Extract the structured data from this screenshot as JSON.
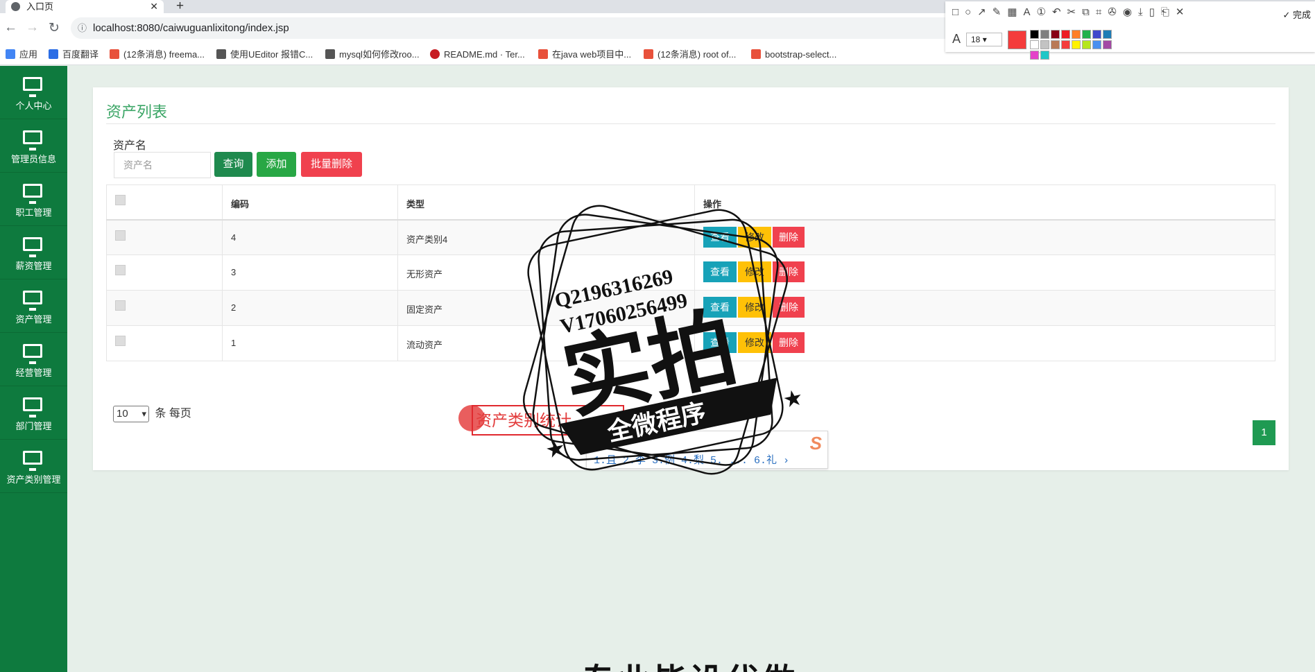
{
  "browser": {
    "tab_title": "入口页",
    "url": "localhost:8080/caiwuguanlixitong/index.jsp",
    "bookmarks": [
      {
        "label": "应用",
        "color": "#4285f4"
      },
      {
        "label": "百度翻译",
        "color": "#2b6de5"
      },
      {
        "label": "(12条消息) freema...",
        "color": "#e8513b"
      },
      {
        "label": "使用UEditor 报错C...",
        "color": "#555555"
      },
      {
        "label": "mysql如何修改roo...",
        "color": "#555555"
      },
      {
        "label": "README.md · Ter...",
        "color": "#c71d23"
      },
      {
        "label": "在java web项目中...",
        "color": "#e8513b"
      },
      {
        "label": "(12条消息) root of...",
        "color": "#e8513b"
      },
      {
        "label": "bootstrap-select...",
        "color": "#e8513b"
      }
    ]
  },
  "annotation_toolbar": {
    "font_size": "18",
    "done_label": "完成",
    "current_color": "#f43c3c",
    "swatches": [
      "#000000",
      "#7f7f7f",
      "#880015",
      "#ed1c24",
      "#ff7f27",
      "#22b14c",
      "#3f48cc",
      "#1e7cb5",
      "#ffffff",
      "#c3c3c3",
      "#b97a57",
      "#f43c3c",
      "#fff200",
      "#b5e61d",
      "#4a8ff0",
      "#a349a4",
      "#e442c9",
      "#20c7c7"
    ]
  },
  "sidebar": {
    "items": [
      {
        "label": "个人中心"
      },
      {
        "label": "管理员信息"
      },
      {
        "label": "职工管理"
      },
      {
        "label": "薪资管理"
      },
      {
        "label": "资产管理"
      },
      {
        "label": "经营管理"
      },
      {
        "label": "部门管理"
      },
      {
        "label": "资产类别管理"
      }
    ]
  },
  "panel": {
    "title": "资产列表",
    "search_label": "资产名",
    "search_placeholder": "资产名",
    "query_label": "查询",
    "add_label": "添加",
    "batch_delete_label": "批量删除",
    "colors": {
      "query": "#1f8a4e",
      "add": "#28a745",
      "delete": "#f0414e",
      "view": "#17a2b8",
      "edit": "#ffc107"
    }
  },
  "table": {
    "headers": {
      "code": "编码",
      "type": "类型",
      "actions": "操作"
    },
    "rows": [
      {
        "code": "4",
        "type": "资产类别4"
      },
      {
        "code": "3",
        "type": "无形资产"
      },
      {
        "code": "2",
        "type": "固定资产"
      },
      {
        "code": "1",
        "type": "流动资产"
      }
    ],
    "action_labels": {
      "view": "查看",
      "edit": "修改",
      "delete": "删除"
    }
  },
  "pagination": {
    "per_page_value": "10",
    "per_page_suffix": "条 每页",
    "current_page": "1"
  },
  "overlay": {
    "annotation_text": "资产类别统计",
    "ime_candidates": "1.且 2.李 3.例 4.梨 5. ... 6.礼 ›",
    "ime_logo": "S"
  },
  "watermark": {
    "line1": "Q2196316269",
    "line2": "V17060256499",
    "big_text": "实拍",
    "banner_text": "全微程序"
  },
  "bottom_text": "专业毕设代做"
}
